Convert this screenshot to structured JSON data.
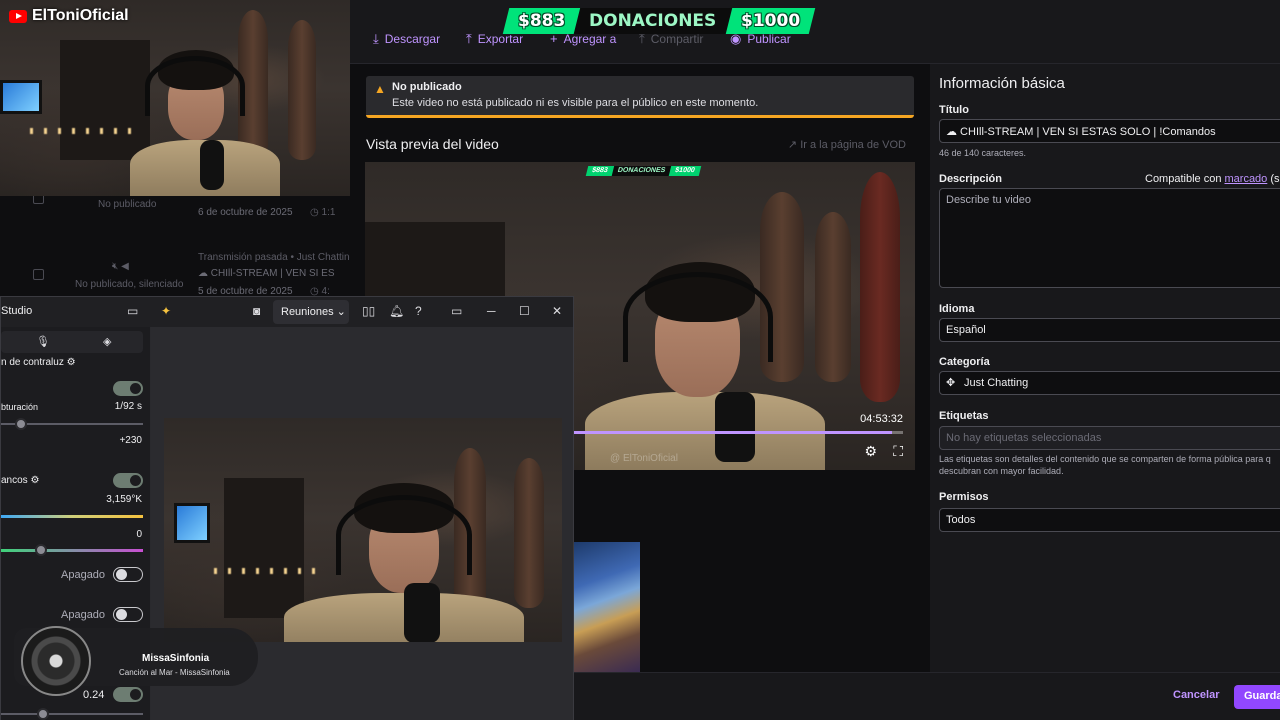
{
  "overlay": {
    "channel_name": "ElToniOficial",
    "banner": {
      "left": "$883",
      "middle": "DONACIONES",
      "right": "$1000"
    }
  },
  "toolbar": {
    "download": "Descargar",
    "export": "Exportar",
    "add_to": "Agregar a",
    "share": "Compartir",
    "publish": "Publicar"
  },
  "video_list": {
    "status_unpublished": "No publicado",
    "date1": "6 de octubre de 2025",
    "info_row": "Transmisión pasada • Just Chatting",
    "title_row": "☁ CHIll-STREAM | VEN SI ES",
    "status_muted": "No publicado, silenciado",
    "date2": "5 de octubre de 2025"
  },
  "alert": {
    "title": "No publicado",
    "message": "Este video no está publicado ni es visible para el público en este momento."
  },
  "preview": {
    "heading": "Vista previa del video",
    "vod_link": "Ir a la página de VOD",
    "time": "04:53:32",
    "progress": 0.98,
    "watermark": "ElToniOficial"
  },
  "info": {
    "heading": "Información básica",
    "title_label": "Título",
    "title_value": "☁ CHIll-STREAM | VEN SI ESTAS SOLO | !Comandos",
    "char_count": "46 de 140 caracteres.",
    "description_label": "Descripción",
    "compat_text": "Compatible con",
    "compat_link": "marcado",
    "compat_suffix": "(s",
    "description_placeholder": "Describe tu video",
    "language_label": "Idioma",
    "language_value": "Español",
    "category_label": "Categoría",
    "category_value": "Just Chatting",
    "tags_label": "Etiquetas",
    "tags_placeholder": "No hay etiquetas seleccionadas",
    "tags_help_1": "Las etiquetas son detalles del contenido que se comparten de forma pública para q",
    "tags_help_2": "descubran con mayor facilidad.",
    "permissions_label": "Permisos",
    "permissions_value": "Todos",
    "cancel": "Cancelar",
    "save": "Guarda"
  },
  "studio": {
    "title": "Studio",
    "meeting_select": "Reuniones",
    "labels": {
      "backlight": "n de contraluz",
      "shutter": "bturación",
      "white_balance": "ancos",
      "off1": "Apagado",
      "off2": "Apagado"
    },
    "values": {
      "shutter": "1/92 s",
      "exposure": "+230",
      "temperature": "3,159°K",
      "tint": "0",
      "last": "0.24"
    }
  },
  "music": {
    "artist": "MissaSinfonia",
    "track": "Canción al Mar - MissaSinfonia"
  }
}
